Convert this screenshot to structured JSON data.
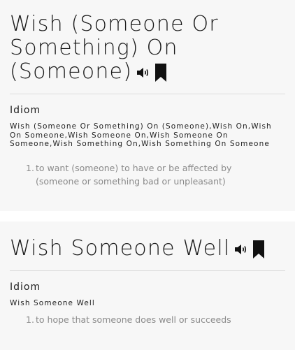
{
  "entries": [
    {
      "headword": "Wish (Someone Or Something) On (Someone)",
      "part_of_speech": "Idiom",
      "variants": "Wish (Someone Or Something) On (Someone),Wish On,Wish On Someone,Wish Someone On,Wish Someone On Someone,Wish Something On,Wish Something On Someone",
      "senses": [
        {
          "number": "1.",
          "text": "to want (someone) to have or be affected by (someone or something bad or unpleasant)"
        }
      ]
    },
    {
      "headword": "Wish Someone Well",
      "part_of_speech": "Idiom",
      "variants": "Wish Someone Well",
      "senses": [
        {
          "number": "1.",
          "text": "to hope that someone does well or succeeds"
        }
      ]
    }
  ],
  "icons": {
    "audio": "speaker-icon",
    "save": "bookmark-icon"
  },
  "colors": {
    "card_background": "#f7f7f7",
    "page_background": "#ffffff",
    "headword": "#1a1a1a",
    "definition": "#8a8a8a",
    "divider": "#dcdcdc"
  }
}
